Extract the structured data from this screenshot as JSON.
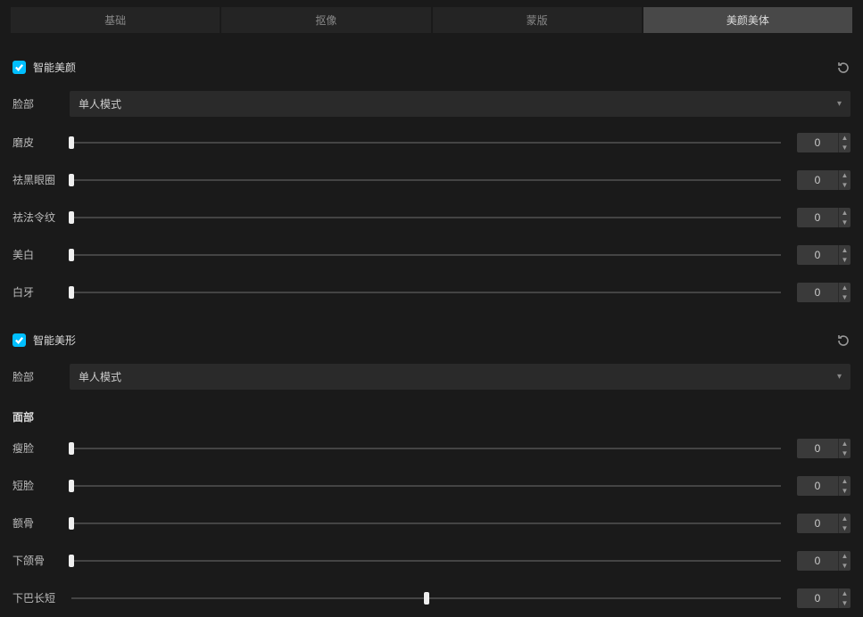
{
  "tabs": {
    "items": [
      {
        "label": "基础"
      },
      {
        "label": "抠像"
      },
      {
        "label": "蒙版"
      },
      {
        "label": "美颜美体"
      }
    ],
    "active_index": 3
  },
  "section_beauty": {
    "title": "智能美颜",
    "checked": true,
    "face_label": "脸部",
    "face_mode": "单人模式",
    "sliders": [
      {
        "label": "磨皮",
        "value": 0,
        "pos": 0
      },
      {
        "label": "祛黑眼圈",
        "value": 0,
        "pos": 0
      },
      {
        "label": "祛法令纹",
        "value": 0,
        "pos": 0
      },
      {
        "label": "美白",
        "value": 0,
        "pos": 0
      },
      {
        "label": "白牙",
        "value": 0,
        "pos": 0
      }
    ]
  },
  "section_shape": {
    "title": "智能美形",
    "checked": true,
    "face_label": "脸部",
    "face_mode": "单人模式",
    "subheader": "面部",
    "sliders": [
      {
        "label": "瘦脸",
        "value": 0,
        "pos": 0
      },
      {
        "label": "短脸",
        "value": 0,
        "pos": 0
      },
      {
        "label": "额骨",
        "value": 0,
        "pos": 0
      },
      {
        "label": "下颌骨",
        "value": 0,
        "pos": 0
      },
      {
        "label": "下巴长短",
        "value": 0,
        "pos": 50
      }
    ]
  }
}
